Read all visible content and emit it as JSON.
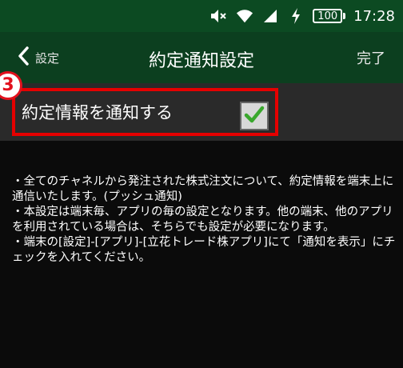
{
  "status_bar": {
    "battery_level": "100",
    "time": "17:28",
    "icons": [
      "mute-icon",
      "wifi-icon",
      "signal-icon",
      "charging-icon",
      "battery-icon"
    ]
  },
  "nav": {
    "back_label": "設定",
    "title": "約定通知設定",
    "done_label": "完了"
  },
  "badge": "3",
  "setting": {
    "label": "約定情報を通知する",
    "checked": true
  },
  "description": [
    "・全てのチャネルから発注された株式注文について、約定情報を端末上に通信いたします。(プッシュ通知)",
    "・本設定は端末毎、アプリの毎の設定となります。他の端末、他のアプリを利用されている場合は、そちらでも設定が必要になります。",
    "・端末の[設定]-[アプリ]-[立花トレード株アプリ]にて「通知を表示」にチェックを入れてください。"
  ],
  "colors": {
    "status_bar": "#0c4a22",
    "nav_bar": "#0c3f1f",
    "background": "#0b0b0b",
    "setting_row": "#2a2a2a",
    "highlight": "#e50000",
    "check": "#3aa82d"
  }
}
